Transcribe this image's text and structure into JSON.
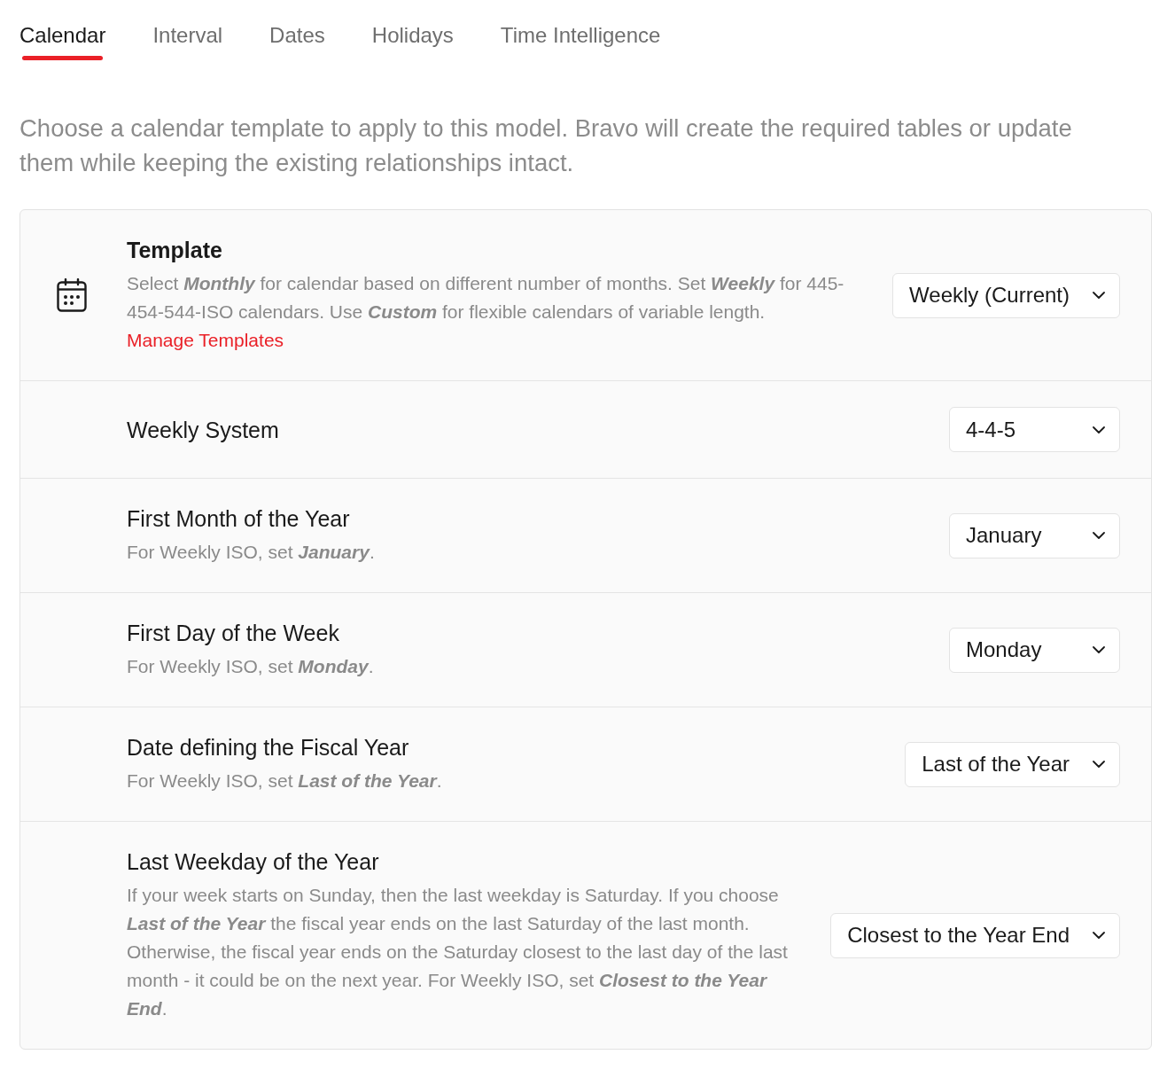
{
  "tabs": [
    {
      "label": "Calendar",
      "selected": true
    },
    {
      "label": "Interval",
      "selected": false
    },
    {
      "label": "Dates",
      "selected": false
    },
    {
      "label": "Holidays",
      "selected": false
    },
    {
      "label": "Time Intelligence",
      "selected": false
    }
  ],
  "intro": "Choose a calendar template to apply to this model. Bravo will create the required tables or update them while keeping the existing relationships intact.",
  "settings": [
    {
      "kind": "template",
      "title": "Template",
      "description": "Select **Monthly** for calendar based on different number of months. Set **Weekly** for 445-454-544-ISO calendars. Use **Custom** for flexible calendars of variable length.",
      "link": "Manage Templates",
      "value": "Weekly (Current)"
    },
    {
      "kind": "option",
      "title": "Weekly System",
      "value": "4-4-5"
    },
    {
      "kind": "option",
      "title": "First Month of the Year",
      "description": "For Weekly ISO, set **January**.",
      "value": "January"
    },
    {
      "kind": "option",
      "title": "First Day of the Week",
      "description": "For Weekly ISO, set **Monday**.",
      "value": "Monday"
    },
    {
      "kind": "option",
      "title": "Date defining the Fiscal Year",
      "description": "For Weekly ISO, set **Last of the Year**.",
      "value": "Last of the Year"
    },
    {
      "kind": "option",
      "title": "Last Weekday of the Year",
      "description": "If your week starts on Sunday, then the last weekday is Saturday. If you choose **Last of the Year** the fiscal year ends on the last Saturday of the last month. Otherwise, the fiscal year ends on the Saturday closest to the last day of the last month - it could be on the next year. For Weekly ISO, set **Closest to the Year End**.",
      "value": "Closest to the Year End"
    }
  ]
}
